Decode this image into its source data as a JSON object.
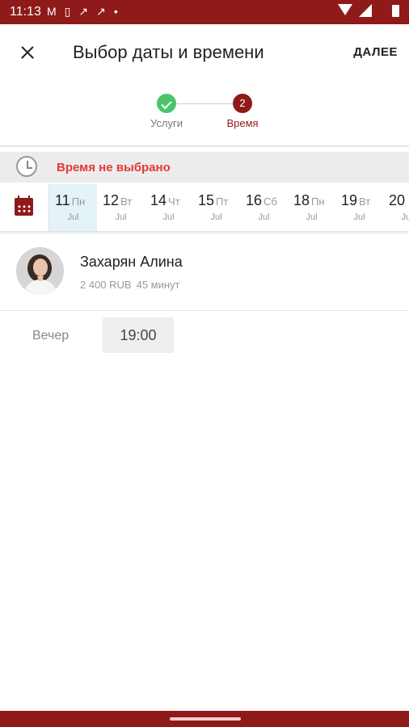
{
  "status_bar": {
    "time": "11:13",
    "left_icons": [
      "gmail-icon",
      "sim-icon",
      "missed-call-icon",
      "missed-call-icon",
      "dot-icon"
    ],
    "right_icons": [
      "wifi-icon",
      "signal-icon",
      "battery-icon"
    ]
  },
  "header": {
    "title": "Выбор даты и времени",
    "next_label": "ДАЛЕЕ"
  },
  "stepper": {
    "steps": [
      {
        "label": "Услуги",
        "state": "done"
      },
      {
        "label": "Время",
        "state": "current",
        "number": "2"
      }
    ]
  },
  "time_status": {
    "message": "Время не выбрано",
    "icon": "clock-icon"
  },
  "dates": [
    {
      "day": "11",
      "weekday": "Пн",
      "month": "Jul",
      "selected": true
    },
    {
      "day": "12",
      "weekday": "Вт",
      "month": "Jul",
      "selected": false
    },
    {
      "day": "14",
      "weekday": "Чт",
      "month": "Jul",
      "selected": false
    },
    {
      "day": "15",
      "weekday": "Пт",
      "month": "Jul",
      "selected": false
    },
    {
      "day": "16",
      "weekday": "Сб",
      "month": "Jul",
      "selected": false
    },
    {
      "day": "18",
      "weekday": "Пн",
      "month": "Jul",
      "selected": false
    },
    {
      "day": "19",
      "weekday": "Вт",
      "month": "Jul",
      "selected": false
    },
    {
      "day": "20",
      "weekday": "",
      "month": "Jul",
      "selected": false
    }
  ],
  "master": {
    "name": "Захарян Алина",
    "price": "2 400 RUB",
    "duration": "45 минут"
  },
  "slots": {
    "period_label": "Вечер",
    "times": [
      "19:00"
    ]
  },
  "colors": {
    "brand": "#8f1a1a",
    "success": "#4cc46e",
    "warning_text": "#e53935",
    "selected_day_bg": "#e4f3f8"
  }
}
